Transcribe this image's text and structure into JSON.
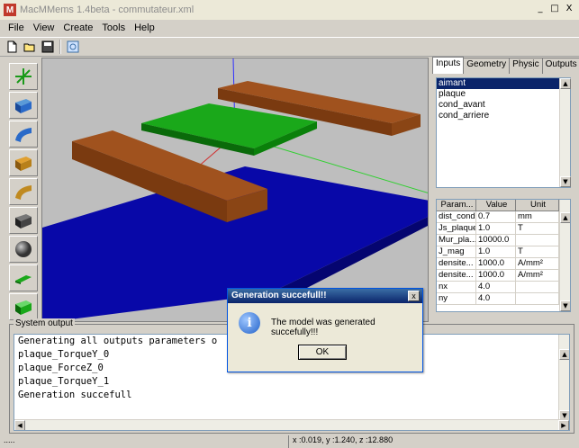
{
  "window": {
    "title": "MacMMems 1.4beta - commutateur.xml",
    "controls": [
      "_",
      "□",
      "X"
    ]
  },
  "menu": [
    "File",
    "View",
    "Create",
    "Tools",
    "Help"
  ],
  "toolbar": {
    "icons": [
      "new-icon",
      "open-icon",
      "save-icon",
      "refresh-icon"
    ]
  },
  "left_tools": [
    "axis-tool-icon",
    "blue-box-icon",
    "blue-curve-icon",
    "orange-box-icon",
    "orange-curve-icon",
    "dark-box-icon",
    "sphere-icon",
    "green-plate-icon",
    "green-box-icon"
  ],
  "right_panel": {
    "tabs": [
      "Inputs",
      "Geometry",
      "Physic",
      "Outputs"
    ],
    "active_tab": "Inputs",
    "list_items": [
      "aimant",
      "plaque",
      "cond_avant",
      "cond_arriere"
    ],
    "selected_item": "aimant",
    "param_headers": [
      "Param...",
      "Value",
      "Unit"
    ],
    "params": [
      [
        "dist_cond",
        "0.7",
        "mm"
      ],
      [
        "Js_plaque",
        "1.0",
        "T"
      ],
      [
        "Mur_pla...",
        "10000.0",
        ""
      ],
      [
        "J_mag",
        "1.0",
        "T"
      ],
      [
        "densite...",
        "1000.0",
        "A/mm²"
      ],
      [
        "densite...",
        "1000.0",
        "A/mm²"
      ],
      [
        "nx",
        "4.0",
        ""
      ],
      [
        "ny",
        "4.0",
        ""
      ]
    ]
  },
  "system_output": {
    "label": "System output",
    "lines": [
      "Generating all outputs parameters o",
      "plaque_TorqueY_0",
      "plaque_ForceZ_0",
      "plaque_TorqueY_1",
      "Generation succefull"
    ]
  },
  "status": {
    "left": ".....",
    "coords": "x :0.019, y :1.240, z :12.880"
  },
  "dialog": {
    "title": "Generation succefull!!",
    "message": "The model was generated succefully!!!",
    "ok_label": "OK",
    "close": "x"
  },
  "colors": {
    "board": "#0a0aa8",
    "bar": "#a0521e",
    "plate": "#1aa81a",
    "background": "#bebebe"
  }
}
